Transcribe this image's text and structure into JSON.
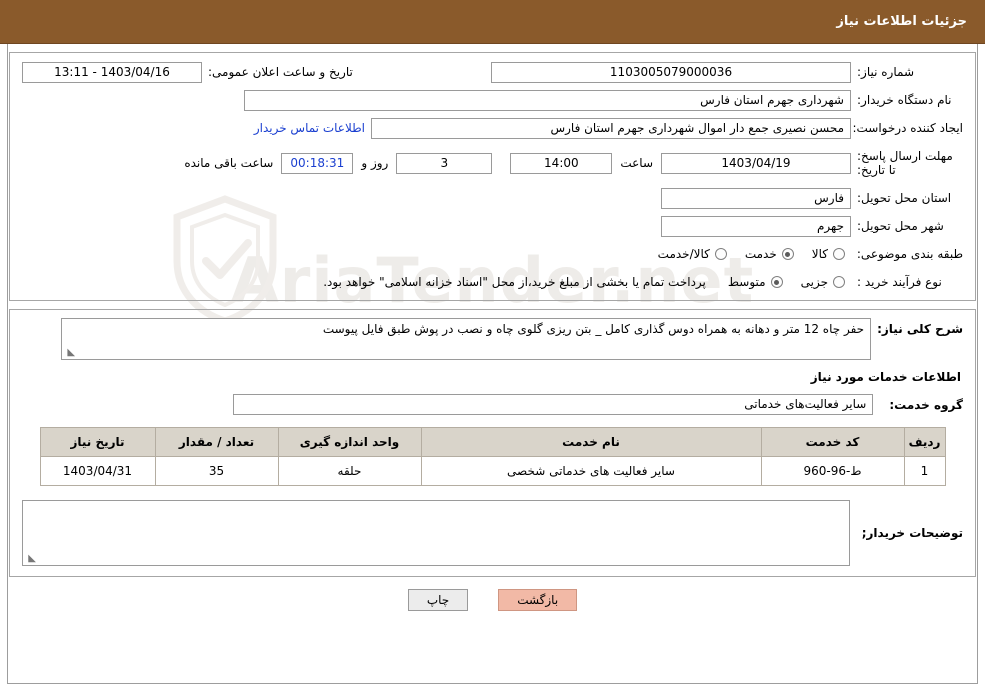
{
  "header": {
    "title": "جزئیات اطلاعات نیاز"
  },
  "watermark": {
    "text": "AriaTender.net"
  },
  "form": {
    "need_number": {
      "label": "شماره نیاز:",
      "value": "1103005079000036"
    },
    "public_announce": {
      "label": "تاریخ و ساعت اعلان عمومی:",
      "value": "1403/04/16 - 13:11"
    },
    "buyer_org": {
      "label": "نام دستگاه خریدار:",
      "value": "شهرداری جهرم استان فارس"
    },
    "requester": {
      "label": "ایجاد کننده درخواست:",
      "value": "محسن نصیری جمع دار اموال  شهرداری جهرم استان فارس"
    },
    "contact_link": {
      "label": "اطلاعات تماس خریدار"
    },
    "deadline": {
      "label": "مهلت ارسال پاسخ: تا تاریخ:",
      "date": "1403/04/19",
      "time_label": "ساعت",
      "time": "14:00",
      "days": "3",
      "days_label": "روز و",
      "remaining": "00:18:31",
      "remaining_label": "ساعت باقی مانده"
    },
    "delivery_province": {
      "label": "استان محل تحویل:",
      "value": "فارس"
    },
    "delivery_city": {
      "label": "شهر محل تحویل:",
      "value": "جهرم"
    },
    "category": {
      "label": "طبقه بندی موضوعی:",
      "options": [
        "کالا",
        "خدمت",
        "کالا/خدمت"
      ],
      "selected": "خدمت"
    },
    "purchase_type": {
      "label": "نوع فرآیند خرید :",
      "options": [
        "جزیی",
        "متوسط"
      ],
      "selected": "متوسط",
      "note": "پرداخت تمام یا بخشی از مبلغ خرید،از محل \"اسناد خزانه اسلامی\" خواهد بود."
    }
  },
  "description": {
    "label": "شرح کلی نیاز:",
    "value": "حفر چاه 12 متر و دهانه به همراه دوس گذاری کامل _ بتن ریزی گلوی چاه و نصب در پوش طبق فایل پیوست"
  },
  "services": {
    "section_title": "اطلاعات خدمات مورد نیاز",
    "group_label": "گروه خدمت:",
    "group_value": "سایر فعالیت‌های خدماتی",
    "columns": [
      "ردیف",
      "کد خدمت",
      "نام خدمت",
      "واحد اندازه گیری",
      "تعداد / مقدار",
      "تاریخ نیاز"
    ],
    "rows": [
      {
        "row": "1",
        "code": "ط-96-960",
        "name": "سایر فعالیت های خدماتی شخصی",
        "unit": "حلقه",
        "qty": "35",
        "date": "1403/04/31"
      }
    ]
  },
  "buyer_notes": {
    "label": "توضیحات خریدار;",
    "value": ""
  },
  "footer": {
    "print_label": "چاپ",
    "back_label": "بازگشت"
  }
}
